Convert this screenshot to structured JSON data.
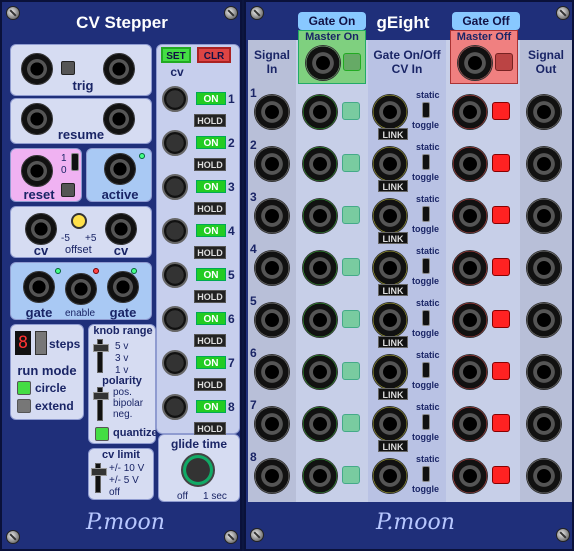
{
  "stepper": {
    "title": "CV Stepper",
    "trig": "trig",
    "resume": "resume",
    "reset": "reset",
    "reset_1": "1",
    "reset_0": "0",
    "active": "active",
    "cv_left": "cv",
    "cv_right": "cv",
    "offset": "offset",
    "offset_min": "-5",
    "offset_max": "+5",
    "gate_left": "gate",
    "gate_right": "gate",
    "enable": "enable",
    "set": "SET",
    "clr": "CLR",
    "cv_header": "cv",
    "on": "ON",
    "hold": "HOLD",
    "steps_digit": "8",
    "steps": "steps",
    "run_mode": "run mode",
    "circle": "circle",
    "extend": "extend",
    "knob_range": "knob range",
    "range_5": "5 v",
    "range_3": "3 v",
    "range_1": "1 v",
    "polarity": "polarity",
    "pos": "pos.",
    "bipolar": "bipolar",
    "neg": "neg.",
    "quantize": "quantize",
    "cv_limit": "cv limit",
    "limit_10": "+/- 10 V",
    "limit_5": "+/-  5 V",
    "limit_off": "off",
    "glide_time": "glide time",
    "glide_off": "off",
    "glide_1sec": "1 sec",
    "logo": "P.moon",
    "step_numbers": [
      "1",
      "2",
      "3",
      "4",
      "5",
      "6",
      "7",
      "8"
    ]
  },
  "geight": {
    "title": "gEight",
    "gate_on": "Gate On",
    "gate_off": "Gate Off",
    "signal_in": "Signal In",
    "master_on": "Master On",
    "cv_in": "Gate On/Off CV In",
    "master_off": "Master Off",
    "signal_out": "Signal Out",
    "link": "LINK",
    "static": "static",
    "toggle": "toggle",
    "logo": "P.moon",
    "rows": [
      "1",
      "2",
      "3",
      "4",
      "5",
      "6",
      "7",
      "8"
    ]
  },
  "colors": {
    "panel": "#1f2f7a",
    "green": "#2c2",
    "red_led": "#f44",
    "pink": "#f0b2f2",
    "light_blue": "#a9c9f4"
  }
}
